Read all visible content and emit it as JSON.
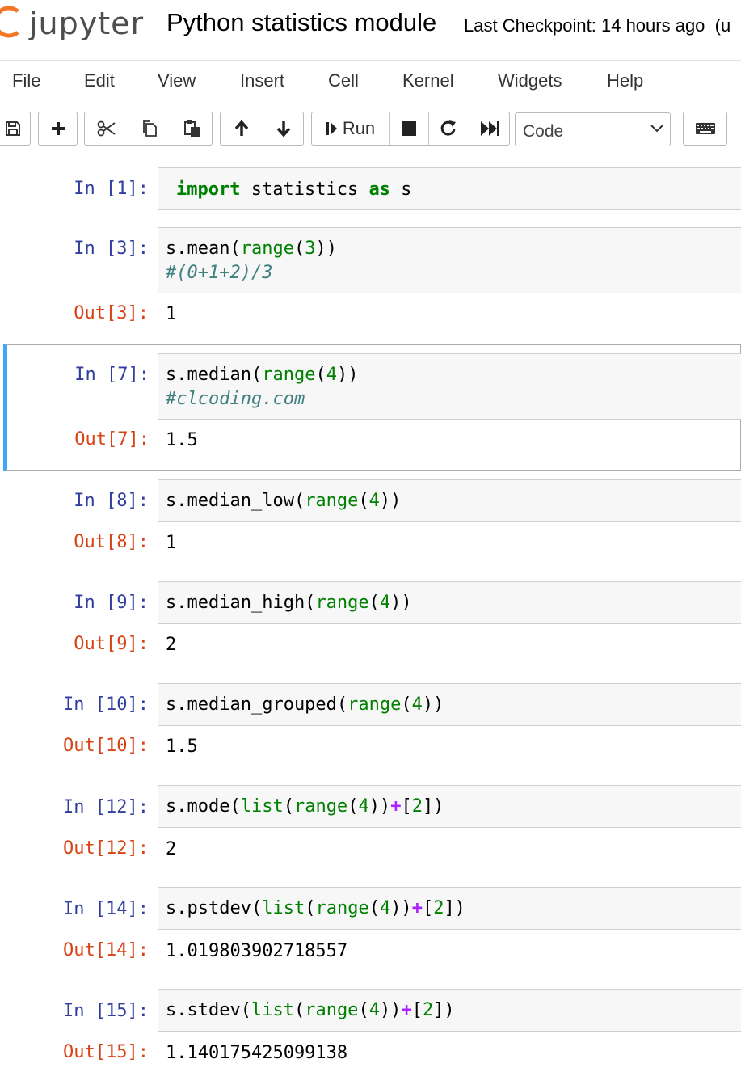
{
  "header": {
    "logo_text": "jupyter",
    "notebook_title": "Python statistics module",
    "checkpoint_text": "Last Checkpoint: 14 hours ago",
    "checkpoint_suffix": "(u"
  },
  "menu": {
    "items": [
      "File",
      "Edit",
      "View",
      "Insert",
      "Cell",
      "Kernel",
      "Widgets",
      "Help"
    ]
  },
  "toolbar": {
    "run_label": "Run",
    "cell_type": "Code",
    "icons": [
      "save-icon",
      "plus-icon",
      "scissors-icon",
      "copy-icon",
      "paste-icon",
      "arrow-up-icon",
      "arrow-down-icon",
      "step-forward-icon",
      "stop-icon",
      "restart-icon",
      "fast-forward-icon",
      "keyboard-icon"
    ]
  },
  "cells": [
    {
      "in": "In [1]:",
      "out": null,
      "code": [
        "import statistics as s"
      ],
      "output": null
    },
    {
      "in": "In [3]:",
      "out": "Out[3]:",
      "code": [
        "s.mean(range(3))",
        "#(0+1+2)/3"
      ],
      "output": "1"
    },
    {
      "in": "In [7]:",
      "out": "Out[7]:",
      "code": [
        "s.median(range(4))",
        "#clcoding.com"
      ],
      "output": "1.5",
      "selected": true
    },
    {
      "in": "In [8]:",
      "out": "Out[8]:",
      "code": [
        "s.median_low(range(4))"
      ],
      "output": "1"
    },
    {
      "in": "In [9]:",
      "out": "Out[9]:",
      "code": [
        "s.median_high(range(4))"
      ],
      "output": "2"
    },
    {
      "in": "In [10]:",
      "out": "Out[10]:",
      "code": [
        "s.median_grouped(range(4))"
      ],
      "output": "1.5"
    },
    {
      "in": "In [12]:",
      "out": "Out[12]:",
      "code": [
        "s.mode(list(range(4))+[2])"
      ],
      "output": "2"
    },
    {
      "in": "In [14]:",
      "out": "Out[14]:",
      "code": [
        "s.pstdev(list(range(4))+[2])"
      ],
      "output": "1.019803902718557"
    },
    {
      "in": "In [15]:",
      "out": "Out[15]:",
      "code": [
        "s.stdev(list(range(4))+[2])"
      ],
      "output": "1.140175425099138"
    }
  ]
}
